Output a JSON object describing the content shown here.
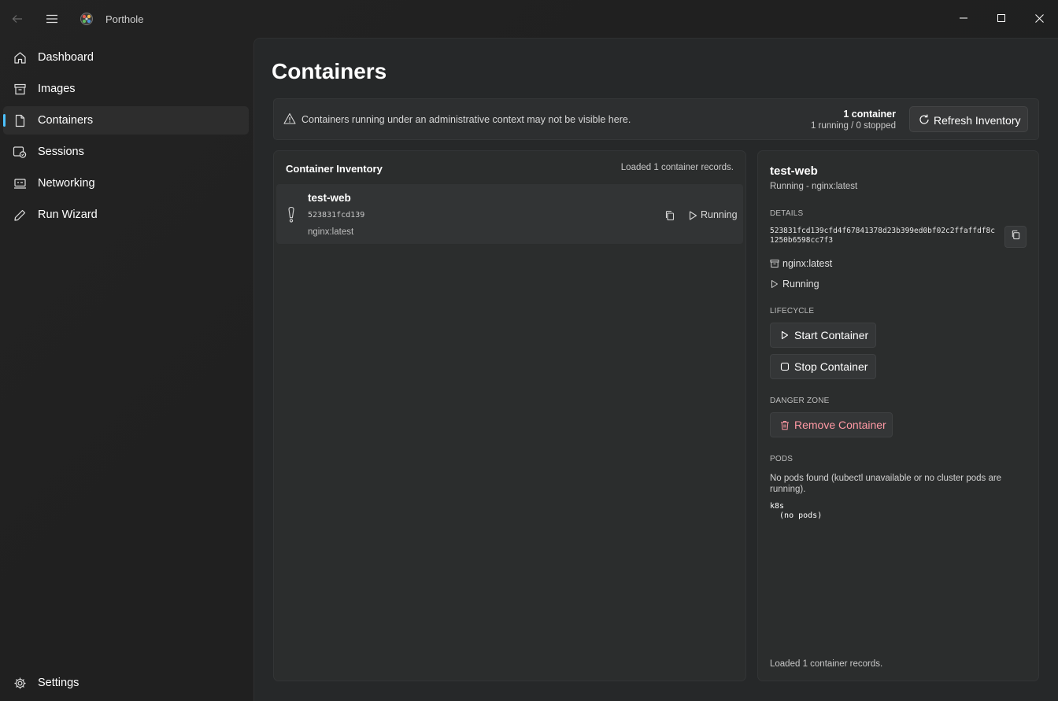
{
  "app": {
    "title": "Porthole"
  },
  "sidebar": {
    "items": [
      {
        "label": "Dashboard",
        "icon": "home-icon"
      },
      {
        "label": "Images",
        "icon": "archive-icon"
      },
      {
        "label": "Containers",
        "icon": "document-icon",
        "active": true
      },
      {
        "label": "Sessions",
        "icon": "sessions-icon"
      },
      {
        "label": "Networking",
        "icon": "network-icon"
      },
      {
        "label": "Run Wizard",
        "icon": "pencil-icon"
      }
    ],
    "settings_label": "Settings"
  },
  "page": {
    "title": "Containers"
  },
  "infobar": {
    "message": "Containers running under an administrative context may not be visible here.",
    "count": "1 container",
    "count_detail": "1 running / 0 stopped",
    "refresh_label": "Refresh Inventory"
  },
  "inventory": {
    "title": "Container Inventory",
    "status": "Loaded 1 container records.",
    "rows": [
      {
        "name": "test-web",
        "short_id": "523831fcd139",
        "image": "nginx:latest",
        "state": "Running"
      }
    ]
  },
  "details": {
    "name": "test-web",
    "subtitle": "Running - nginx:latest",
    "details_heading": "DETAILS",
    "full_id": "523831fcd139cfd4f67841378d23b399ed0bf02c2ffaffdf8c1250b6598cc7f3",
    "image": "nginx:latest",
    "state": "Running",
    "lifecycle_heading": "LIFECYCLE",
    "start_label": "Start Container",
    "stop_label": "Stop Container",
    "danger_heading": "DANGER ZONE",
    "remove_label": "Remove Container",
    "pods_heading": "PODS",
    "pods_message": "No pods found (kubectl unavailable or no cluster pods are running).",
    "pods_output": "k8s\n  (no pods)",
    "footer": "Loaded 1 container records."
  },
  "colors": {
    "accent": "#4cc2ff",
    "danger": "#ff99a4"
  }
}
